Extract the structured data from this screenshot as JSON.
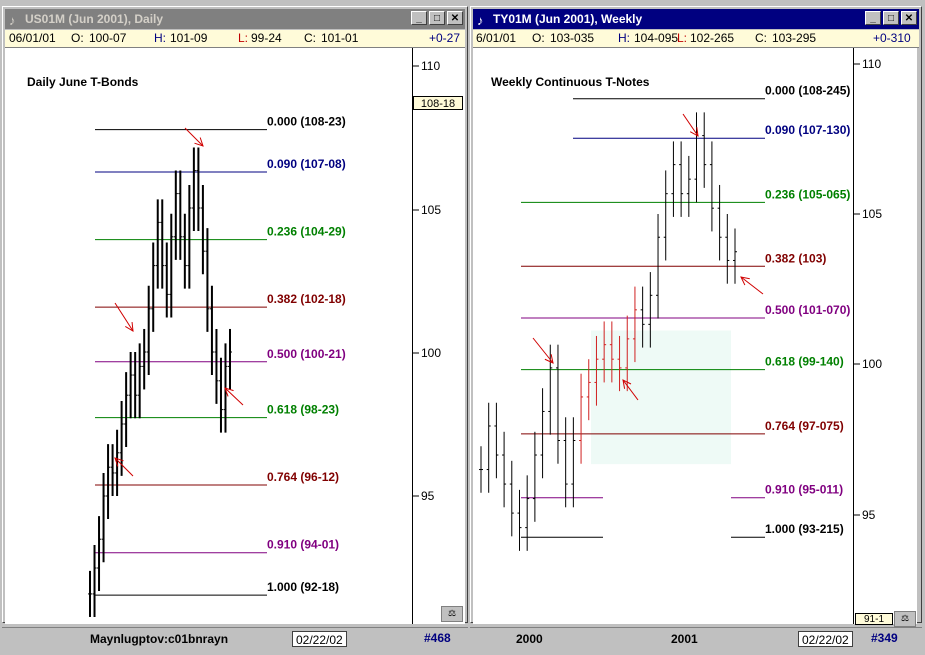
{
  "windows": [
    {
      "title": "US01M (Jun 2001), Daily",
      "info": {
        "date": "06/01/01",
        "o_label": "O:",
        "o": "100-07",
        "h_label": "H:",
        "h": "101-09",
        "l_label": "L:",
        "l": "99-24",
        "c_label": "C:",
        "c": "101-01",
        "change": "+0-27"
      },
      "price_marker": "108-18",
      "footer": {
        "text": "Maynlugptov:c01bnrayn",
        "date": "02/22/02",
        "count": "#468"
      }
    },
    {
      "title": "TY01M (Jun 2001), Weekly",
      "info": {
        "date": "6/01/01",
        "o_label": "O:",
        "o": "103-035",
        "h_label": "H:",
        "h": "104-095",
        "l_label": "L:",
        "l": "102-265",
        "c_label": "C:",
        "c": "103-295",
        "change": "+0-310"
      },
      "price_marker": "91-1",
      "footer": {
        "date": "02/22/02",
        "count": "#349",
        "x_labels": [
          "2000",
          "2001"
        ]
      }
    }
  ],
  "chart_data": [
    {
      "type": "fibonacci_retracement",
      "title": "Daily June T-Bonds",
      "ylim": [
        91,
        111
      ],
      "yticks": [
        "110",
        "105",
        "100",
        "95"
      ],
      "levels": [
        {
          "label": "0.000 (108-23)",
          "price": 108.72,
          "color": "#000000"
        },
        {
          "label": "0.090 (107-08)",
          "price": 107.25,
          "color": "#000080"
        },
        {
          "label": "0.236 (104-29)",
          "price": 104.9,
          "color": "#008000"
        },
        {
          "label": "0.382 (102-18)",
          "price": 102.56,
          "color": "#800000"
        },
        {
          "label": "0.500 (100-21)",
          "price": 100.66,
          "color": "#800080"
        },
        {
          "label": "0.618 (98-23)",
          "price": 98.72,
          "color": "#008000"
        },
        {
          "label": "0.764 (96-12)",
          "price": 96.38,
          "color": "#800000"
        },
        {
          "label": "0.910 (94-01)",
          "price": 94.03,
          "color": "#800080"
        },
        {
          "label": "1.000 (92-18)",
          "price": 92.56,
          "color": "#000000"
        }
      ],
      "price_series_approx": [
        92.6,
        93.5,
        94.5,
        96.0,
        97.0,
        96.8,
        97.5,
        98.5,
        99.5,
        100.2,
        99.5,
        100.5,
        101.0,
        102.5,
        104.0,
        105.5,
        104.0,
        103.0,
        105.0,
        106.5,
        105.0,
        104.0,
        106.0,
        107.3,
        106.0,
        104.5,
        102.5,
        101.0,
        100.0,
        99.0,
        100.5,
        101.0
      ]
    },
    {
      "type": "fibonacci_retracement",
      "title": "Weekly Continuous T-Notes",
      "ylim": [
        91,
        110
      ],
      "yticks": [
        "110",
        "105",
        "100",
        "95"
      ],
      "x_labels": [
        "2000",
        "2001"
      ],
      "levels": [
        {
          "label": "0.000 (108-245)",
          "price": 108.77,
          "color": "#000000"
        },
        {
          "label": "0.090 (107-130)",
          "price": 107.41,
          "color": "#000080"
        },
        {
          "label": "0.236 (105-065)",
          "price": 105.2,
          "color": "#008000"
        },
        {
          "label": "0.382 (103)",
          "price": 103.0,
          "color": "#800000"
        },
        {
          "label": "0.500 (101-070)",
          "price": 101.22,
          "color": "#800080"
        },
        {
          "label": "0.618 (99-140)",
          "price": 99.44,
          "color": "#008000"
        },
        {
          "label": "0.764 (97-075)",
          "price": 97.23,
          "color": "#800000"
        },
        {
          "label": "0.910 (95-011)",
          "price": 95.03,
          "color": "#800080"
        },
        {
          "label": "1.000 (93-215)",
          "price": 93.67,
          "color": "#000000"
        }
      ],
      "price_series_approx": [
        96.0,
        97.5,
        96.5,
        95.5,
        94.5,
        94.0,
        95.0,
        96.5,
        98.0,
        99.5,
        97.0,
        95.5,
        97.0,
        98.5,
        99.0,
        99.8,
        100.3,
        99.8,
        99.5,
        100.5,
        101.5,
        101.0,
        102.0,
        104.0,
        105.5,
        106.5,
        105.5,
        106.0,
        107.5,
        106.5,
        105.0,
        104.0,
        103.2,
        103.5
      ]
    }
  ]
}
